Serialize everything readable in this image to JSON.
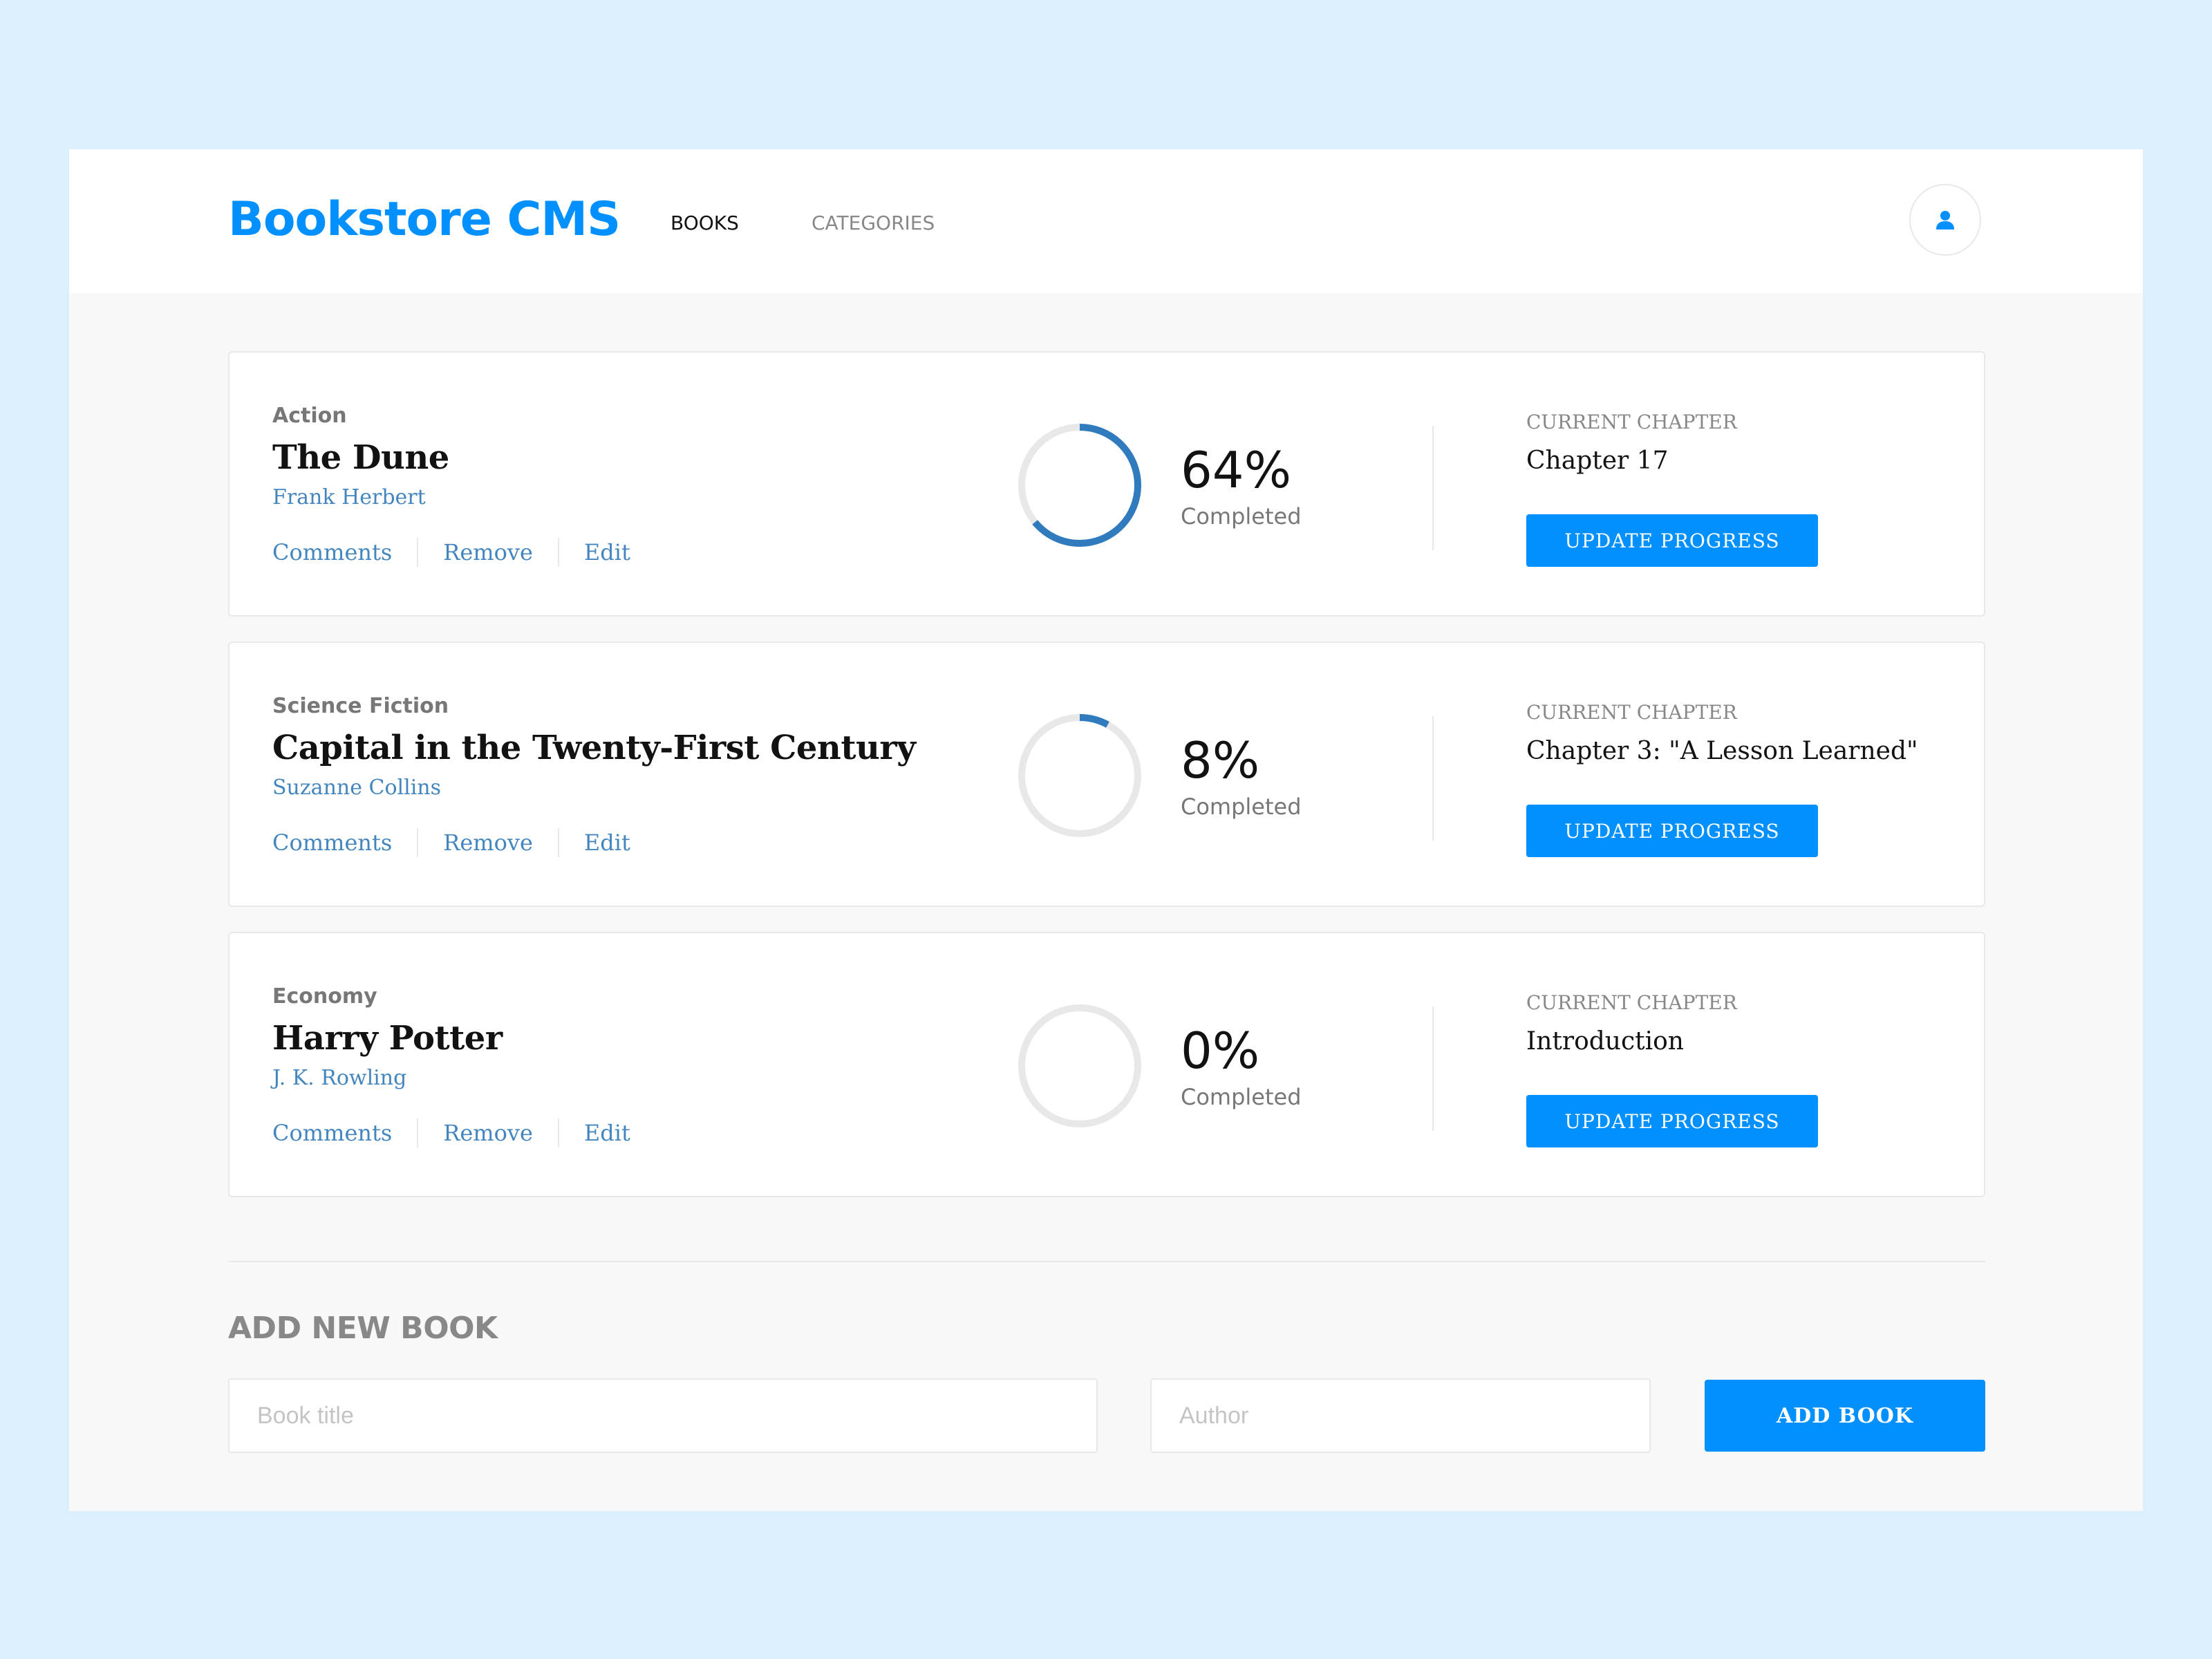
{
  "app": {
    "logo": "Bookstore CMS",
    "nav": [
      {
        "label": "BOOKS",
        "active": true
      },
      {
        "label": "CATEGORIES",
        "active": false
      }
    ],
    "user_icon": "user-icon"
  },
  "colors": {
    "accent": "#0290ff",
    "progress": "#307bbe",
    "track": "#e8e8e8",
    "page_background": "#dbeffc"
  },
  "books": [
    {
      "genre": "Action",
      "title": "The Dune",
      "author": "Frank Herbert",
      "actions": [
        "Comments",
        "Remove",
        "Edit"
      ],
      "progress": 64,
      "progress_text": "64%",
      "completed_label": "Completed",
      "chapter_label": "CURRENT CHAPTER",
      "chapter": "Chapter 17",
      "update_label": "UPDATE PROGRESS"
    },
    {
      "genre": "Science Fiction",
      "title": "Capital in the Twenty-First Century",
      "author": "Suzanne Collins",
      "actions": [
        "Comments",
        "Remove",
        "Edit"
      ],
      "progress": 8,
      "progress_text": "8%",
      "completed_label": "Completed",
      "chapter_label": "CURRENT CHAPTER",
      "chapter": "Chapter 3: \"A Lesson Learned\"",
      "update_label": "UPDATE PROGRESS"
    },
    {
      "genre": "Economy",
      "title": "Harry Potter",
      "author": "J. K. Rowling",
      "actions": [
        "Comments",
        "Remove",
        "Edit"
      ],
      "progress": 0,
      "progress_text": "0%",
      "completed_label": "Completed",
      "chapter_label": "CURRENT CHAPTER",
      "chapter": "Introduction",
      "update_label": "UPDATE PROGRESS"
    }
  ],
  "add_form": {
    "heading": "ADD NEW BOOK",
    "title_placeholder": "Book title",
    "title_value": "",
    "author_placeholder": "Author",
    "author_value": "",
    "submit_label": "ADD BOOK"
  }
}
